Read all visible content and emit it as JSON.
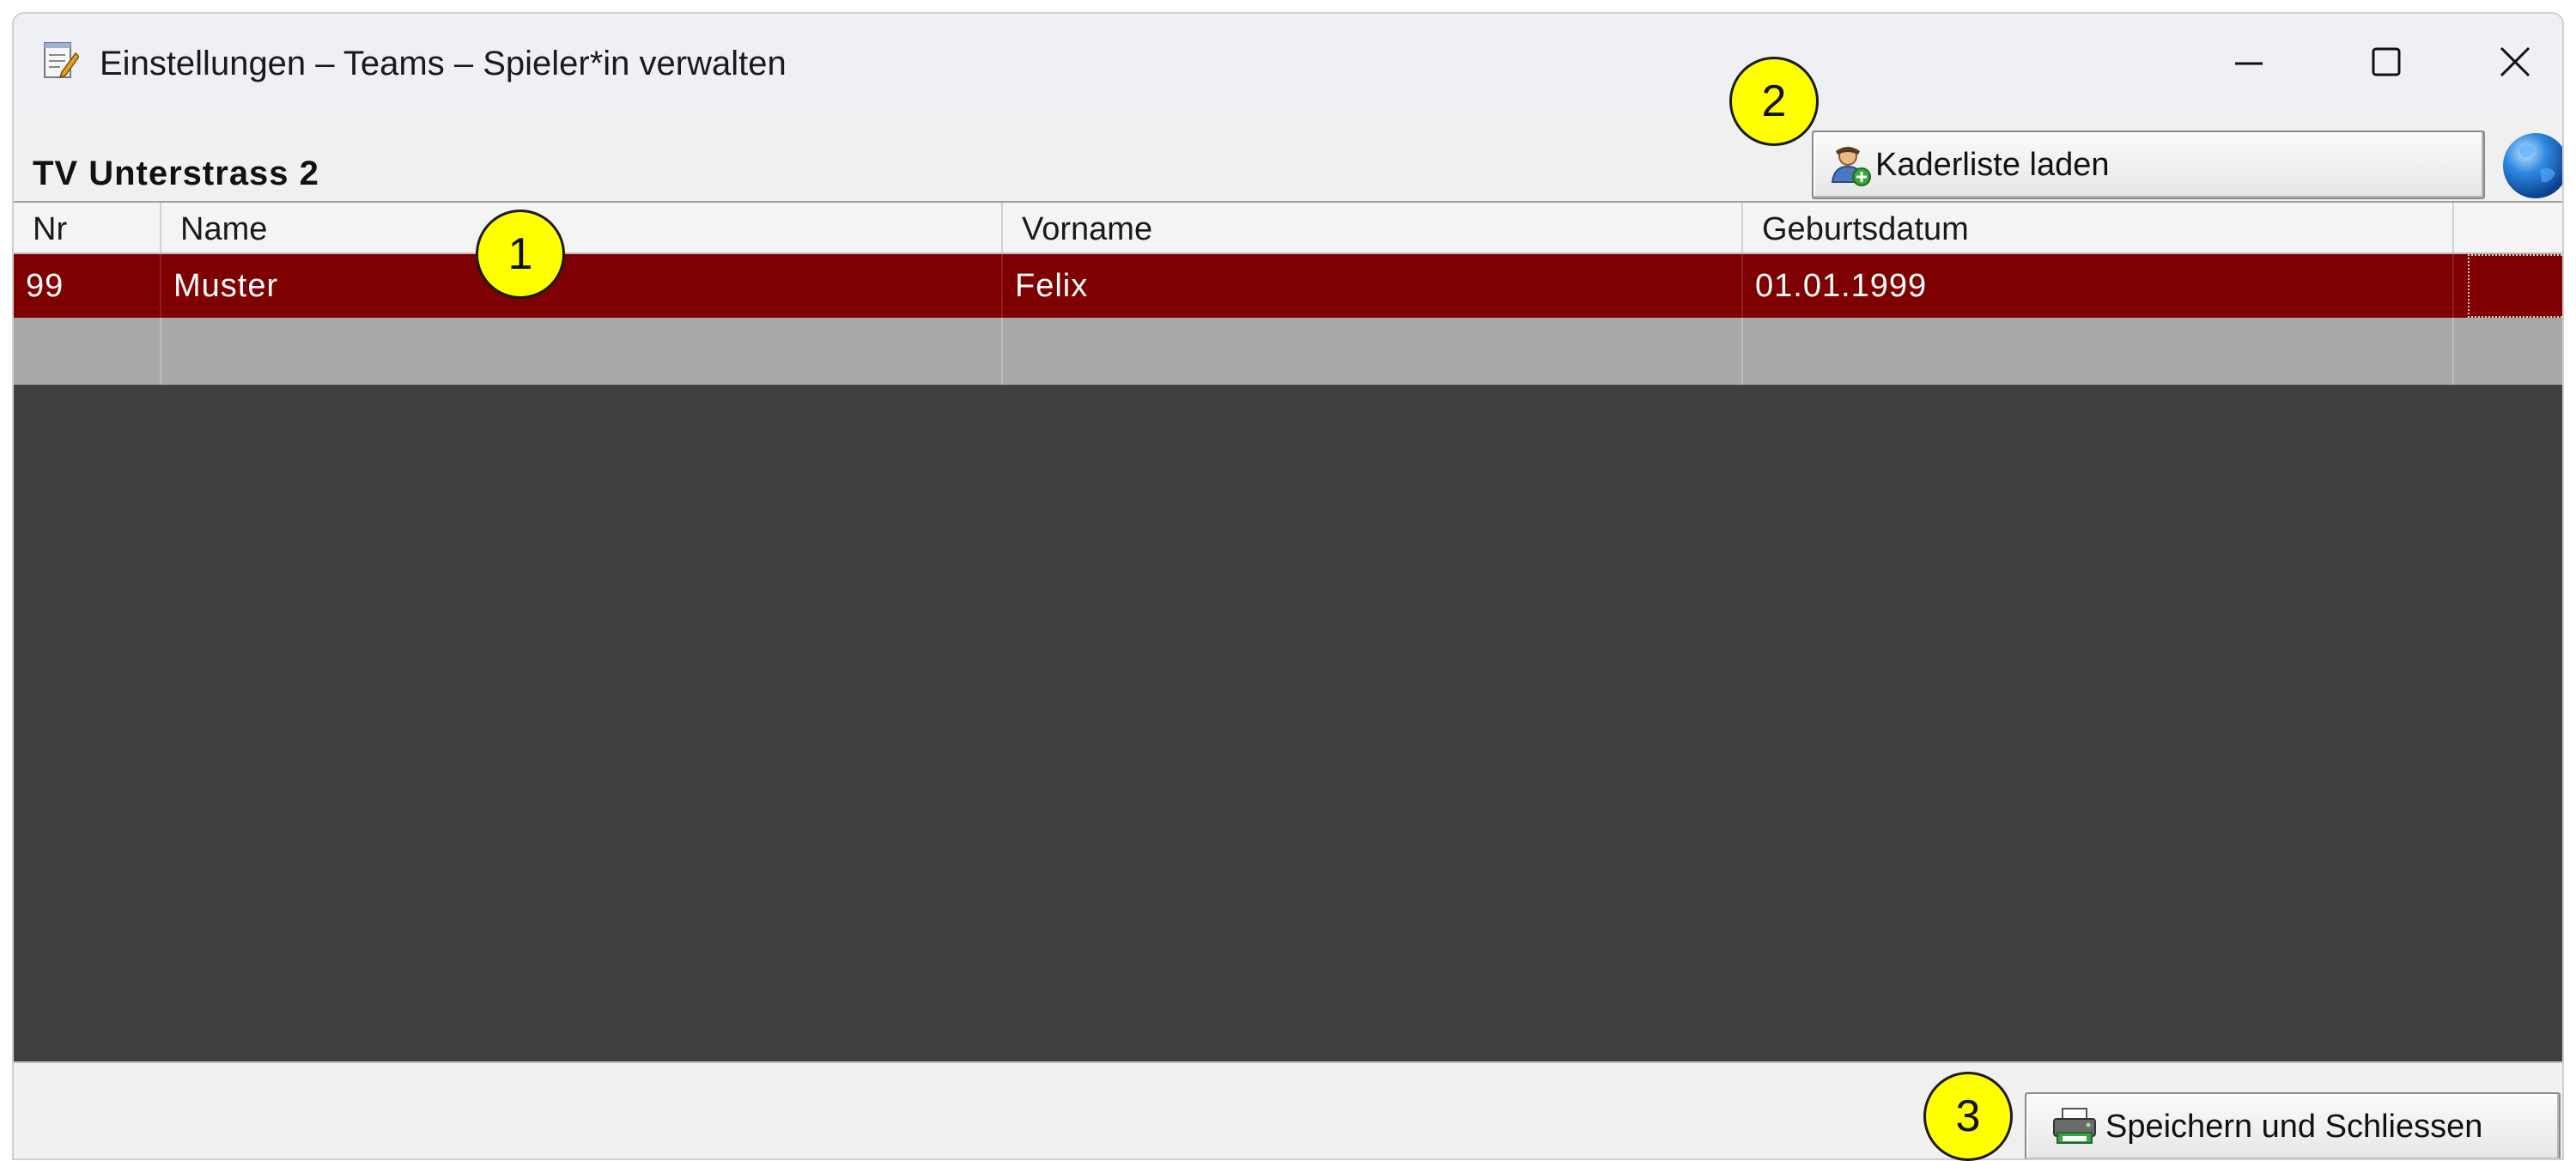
{
  "window": {
    "title": "Einstellungen – Teams – Spieler*in verwalten",
    "app_icon": "notepad-edit-icon",
    "controls": [
      "minimize-icon",
      "maximize-icon",
      "close-icon"
    ]
  },
  "header": {
    "team_name": "TV Unterstrass 2",
    "load_roster_button": {
      "label": "Kaderliste laden",
      "icon": "user-add-icon"
    },
    "globe_icon": "globe-icon"
  },
  "grid": {
    "columns": [
      "Nr",
      "Name",
      "Vorname",
      "Geburtsdatum",
      ""
    ],
    "rows": [
      {
        "nr": "99",
        "name": "Muster",
        "vorname": "Felix",
        "geburtsdatum": "01.01.1999",
        "selected": true
      }
    ],
    "selected_row_color": "#7f0000",
    "empty_row_color": "#a8a8a8",
    "background_color": "#404040"
  },
  "footer": {
    "save_button": {
      "label": "Speichern und Schliessen",
      "icon": "printer-save-icon"
    }
  },
  "callouts": [
    "1",
    "2",
    "3"
  ],
  "callout_color": "#ffff00"
}
